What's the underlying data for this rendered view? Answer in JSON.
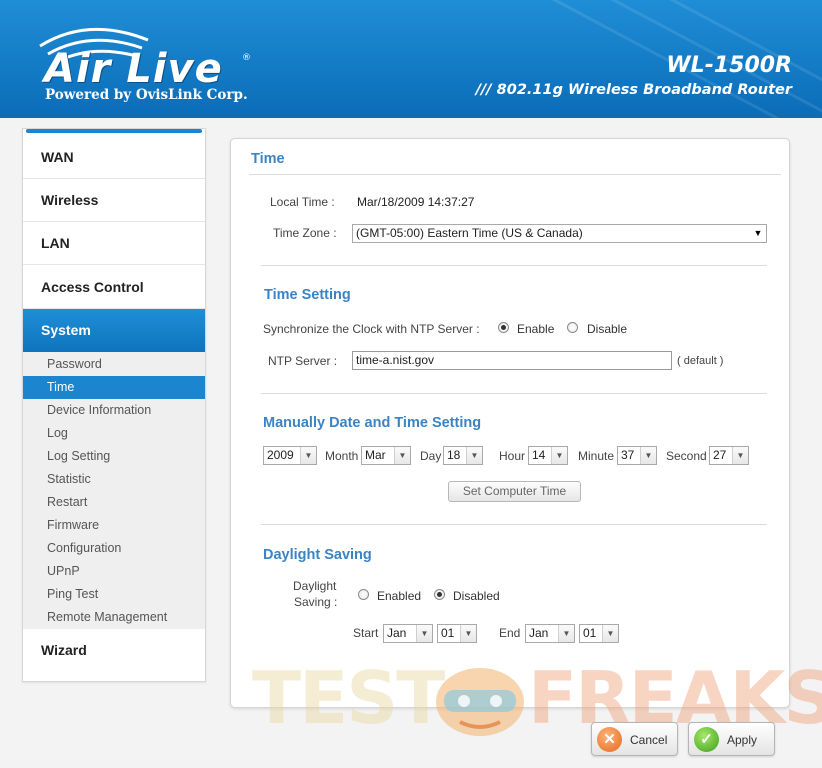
{
  "brand": {
    "logo_text": "Air Live",
    "registered_mark": "®",
    "tagline": "Powered by OvisLink Corp.",
    "model": "WL-1500R",
    "model_description": "/// 802.11g Wireless Broadband Router",
    "header_color": "#1083cf"
  },
  "sidebar": {
    "main_items": [
      {
        "label": "WAN"
      },
      {
        "label": "Wireless"
      },
      {
        "label": "LAN"
      },
      {
        "label": "Access Control"
      },
      {
        "label": "System",
        "active": true
      },
      {
        "label": "Wizard"
      }
    ],
    "sub_items": [
      {
        "label": "Password"
      },
      {
        "label": "Time",
        "active": true
      },
      {
        "label": "Device Information"
      },
      {
        "label": "Log"
      },
      {
        "label": "Log Setting"
      },
      {
        "label": "Statistic"
      },
      {
        "label": "Restart"
      },
      {
        "label": "Firmware"
      },
      {
        "label": "Configuration"
      },
      {
        "label": "UPnP"
      },
      {
        "label": "Ping Test"
      },
      {
        "label": "Remote Management"
      }
    ]
  },
  "page": {
    "title": "Time",
    "local_time_label": "Local Time :",
    "local_time_value": "Mar/18/2009 14:37:27",
    "time_zone_label": "Time Zone :",
    "time_zone_value": "(GMT-05:00) Eastern Time (US & Canada)"
  },
  "time_setting": {
    "title": "Time Setting",
    "sync_label": "Synchronize the Clock with NTP Server :",
    "enable_label": "Enable",
    "disable_label": "Disable",
    "sync_selected": "Enable",
    "ntp_label": "NTP Server :",
    "ntp_value": "time-a.nist.gov",
    "ntp_note": "( default )"
  },
  "manual": {
    "title": "Manually Date and Time Setting",
    "year": "2009",
    "month_label": "Month",
    "month": "Mar",
    "day_label": "Day",
    "day": "18",
    "hour_label": "Hour",
    "hour": "14",
    "minute_label": "Minute",
    "minute": "37",
    "second_label": "Second",
    "second": "27",
    "set_button": "Set Computer Time"
  },
  "daylight": {
    "title": "Daylight Saving",
    "label_line1": "Daylight",
    "label_line2": "Saving :",
    "enabled_label": "Enabled",
    "disabled_label": "Disabled",
    "selected": "Disabled",
    "start_label": "Start",
    "start_month": "Jan",
    "start_day": "01",
    "end_label": "End",
    "end_month": "Jan",
    "end_day": "01"
  },
  "actions": {
    "cancel": "Cancel",
    "apply": "Apply"
  },
  "watermark": {
    "part1": "TEST",
    "part2": "FREAKS"
  }
}
